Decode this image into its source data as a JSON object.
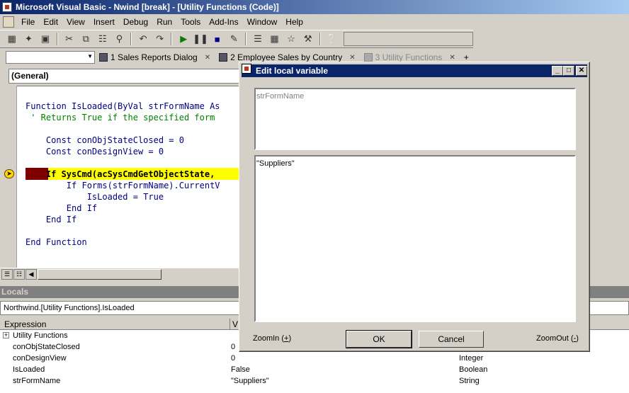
{
  "window": {
    "title": "Microsoft Visual Basic - Nwind [break] - [Utility Functions (Code)]"
  },
  "menu": [
    "File",
    "Edit",
    "View",
    "Insert",
    "Debug",
    "Run",
    "Tools",
    "Add-Ins",
    "Window",
    "Help"
  ],
  "doc_tabs": [
    {
      "label": "1 Sales Reports Dialog",
      "dim": false
    },
    {
      "label": "2 Employee Sales by Country",
      "dim": false
    },
    {
      "label": "3 Utility Functions",
      "dim": true
    }
  ],
  "code": {
    "procedure_combo": "(General)",
    "lines": [
      "Function IsLoaded(ByVal strFormName As",
      " ' Returns True if the specified form",
      "",
      "    Const conObjStateClosed = 0",
      "    Const conDesignView = 0",
      "",
      "    If SysCmd(acSysCmdGetObjectState,",
      "        If Forms(strFormName).CurrentV",
      "            IsLoaded = True",
      "        End If",
      "    End If",
      "",
      "End Function"
    ]
  },
  "locals": {
    "title": "Locals",
    "context": "Northwind.[Utility Functions].IsLoaded",
    "columns": [
      "Expression",
      "V"
    ],
    "rows": [
      {
        "expression": "Utility Functions",
        "value": "",
        "type": "",
        "tree": "+"
      },
      {
        "expression": "conObjStateClosed",
        "value": "0",
        "type": ""
      },
      {
        "expression": "conDesignView",
        "value": "0",
        "type": "Integer"
      },
      {
        "expression": "IsLoaded",
        "value": "False",
        "type": "Boolean"
      },
      {
        "expression": "strFormName",
        "value": "\"Suppliers\"",
        "type": "String"
      }
    ]
  },
  "dialog": {
    "title": "Edit local variable",
    "variable_name": "strFormName",
    "value": "\"Suppliers\"",
    "zoom_in": "ZoomIn",
    "zoom_in_key": "+",
    "zoom_out": "ZoomOut",
    "zoom_out_key": "-",
    "ok": "OK",
    "cancel": "Cancel"
  }
}
